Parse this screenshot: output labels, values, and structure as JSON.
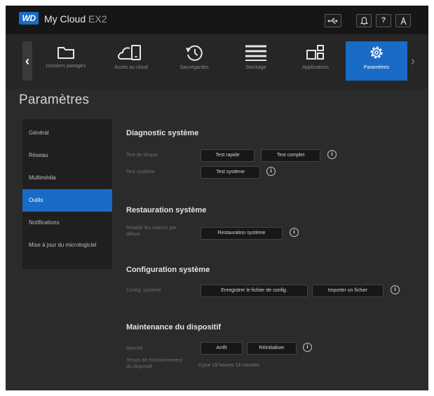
{
  "header": {
    "logo_text": "WD",
    "app_name": "My Cloud",
    "model": "EX2",
    "icons": [
      "usb-icon",
      "bell-icon",
      "help-icon",
      "user-icon"
    ],
    "help_glyph": "?"
  },
  "nav": {
    "prev_glyph": "‹",
    "next_glyph": "›",
    "items": [
      {
        "label": "Dossiers partagés",
        "icon": "folder-icon"
      },
      {
        "label": "Accès au cloud",
        "icon": "cloud-device-icon"
      },
      {
        "label": "Sauvegardes",
        "icon": "backup-clock-icon"
      },
      {
        "label": "Stockage",
        "icon": "storage-icon"
      },
      {
        "label": "Applications",
        "icon": "apps-icon"
      },
      {
        "label": "Paramètres",
        "icon": "gear-icon",
        "active": true
      }
    ]
  },
  "page": {
    "title": "Paramètres"
  },
  "sidebar": {
    "items": [
      {
        "label": "Général"
      },
      {
        "label": "Réseau"
      },
      {
        "label": "Multimédia"
      },
      {
        "label": "Outils",
        "active": true
      },
      {
        "label": "Notifications"
      },
      {
        "label": "Mise à jour du micrologiciel"
      }
    ]
  },
  "diagnostic": {
    "title": "Diagnostic système",
    "disk_label": "Test de disque",
    "quick_test": "Test rapide",
    "full_test": "Test complet",
    "system_label": "Test système",
    "system_test": "Test système"
  },
  "restore": {
    "title": "Restauration système",
    "label_line1": "Rétablir les valeurs par",
    "label_line2": "défaut",
    "button": "Restauration système"
  },
  "config": {
    "title": "Configuration système",
    "label": "Config. système",
    "save_button": "Enregistrer le fichier de config.",
    "import_button": "Importer un fichier"
  },
  "maintenance": {
    "title": "Maintenance du dispositif",
    "power_label": "Marche",
    "stop_button": "Arrêt",
    "reboot_button": "Réinitialiser",
    "uptime_label_line1": "Temps de fonctionnement",
    "uptime_label_line2": "du dispositif",
    "uptime_value": "0 jour 19 heures 19 minutes"
  },
  "colors": {
    "accent": "#1a6bc5",
    "background": "#2b2b2b",
    "topbar": "#161616",
    "sidebar": "#1f1f1f"
  },
  "info_glyph": "i"
}
